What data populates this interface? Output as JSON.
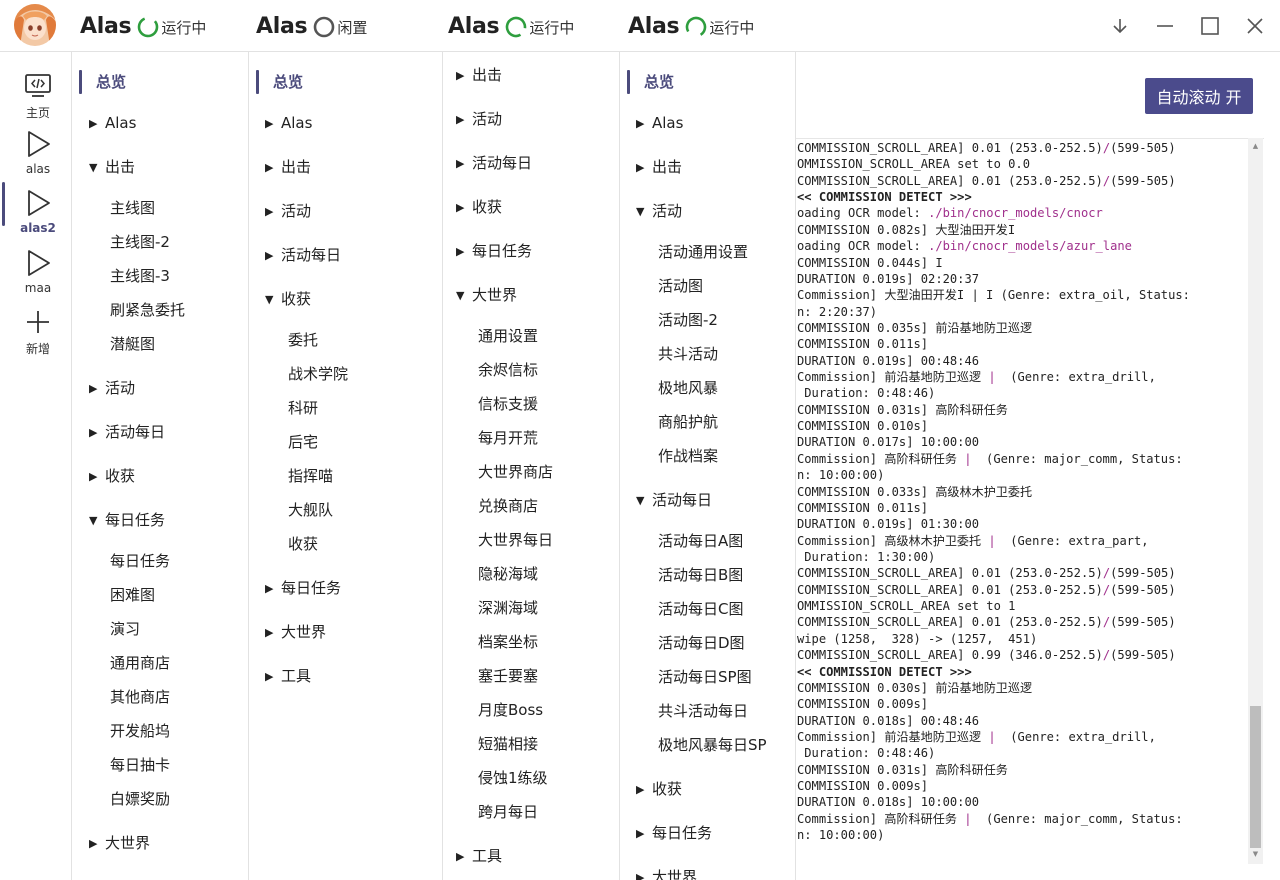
{
  "header": {
    "instances": [
      {
        "name": "Alas",
        "status": "运行中",
        "ring": "running"
      },
      {
        "name": "Alas",
        "status": "闲置",
        "ring": "idle"
      },
      {
        "name": "Alas",
        "status": "运行中",
        "ring": "running"
      },
      {
        "name": "Alas",
        "status": "运行中",
        "ring": "running"
      }
    ],
    "window_controls": [
      "down-arrow-icon",
      "minimize-icon",
      "maximize-icon",
      "close-icon"
    ]
  },
  "rail": {
    "items": [
      {
        "label": "主页",
        "icon": "code-monitor-icon",
        "active": false
      },
      {
        "label": "alas",
        "icon": "play-icon",
        "active": false
      },
      {
        "label": "alas2",
        "icon": "play-icon",
        "active": true
      },
      {
        "label": "maa",
        "icon": "play-icon",
        "active": false
      },
      {
        "label": "新增",
        "icon": "plus-icon",
        "active": false
      }
    ]
  },
  "columns": [
    {
      "items": [
        {
          "label": "总览",
          "type": "overview"
        },
        {
          "label": "Alas",
          "type": "group",
          "expanded": false
        },
        {
          "label": "出击",
          "type": "group",
          "expanded": true
        },
        {
          "label": "主线图",
          "type": "sub"
        },
        {
          "label": "主线图-2",
          "type": "sub"
        },
        {
          "label": "主线图-3",
          "type": "sub"
        },
        {
          "label": "刷紧急委托",
          "type": "sub"
        },
        {
          "label": "潜艇图",
          "type": "sub"
        },
        {
          "label": "活动",
          "type": "group",
          "expanded": false
        },
        {
          "label": "活动每日",
          "type": "group",
          "expanded": false
        },
        {
          "label": "收获",
          "type": "group",
          "expanded": false
        },
        {
          "label": "每日任务",
          "type": "group",
          "expanded": true
        },
        {
          "label": "每日任务",
          "type": "sub"
        },
        {
          "label": "困难图",
          "type": "sub"
        },
        {
          "label": "演习",
          "type": "sub"
        },
        {
          "label": "通用商店",
          "type": "sub"
        },
        {
          "label": "其他商店",
          "type": "sub"
        },
        {
          "label": "开发船坞",
          "type": "sub"
        },
        {
          "label": "每日抽卡",
          "type": "sub"
        },
        {
          "label": "白嫖奖励",
          "type": "sub"
        },
        {
          "label": "大世界",
          "type": "group",
          "expanded": false
        }
      ]
    },
    {
      "items": [
        {
          "label": "总览",
          "type": "overview"
        },
        {
          "label": "Alas",
          "type": "group",
          "expanded": false
        },
        {
          "label": "出击",
          "type": "group",
          "expanded": false
        },
        {
          "label": "活动",
          "type": "group",
          "expanded": false
        },
        {
          "label": "活动每日",
          "type": "group",
          "expanded": false
        },
        {
          "label": "收获",
          "type": "group",
          "expanded": true
        },
        {
          "label": "委托",
          "type": "sub"
        },
        {
          "label": "战术学院",
          "type": "sub"
        },
        {
          "label": "科研",
          "type": "sub"
        },
        {
          "label": "后宅",
          "type": "sub"
        },
        {
          "label": "指挥喵",
          "type": "sub"
        },
        {
          "label": "大舰队",
          "type": "sub"
        },
        {
          "label": "收获",
          "type": "sub"
        },
        {
          "label": "每日任务",
          "type": "group",
          "expanded": false
        },
        {
          "label": "大世界",
          "type": "group",
          "expanded": false
        },
        {
          "label": "工具",
          "type": "group",
          "expanded": false
        }
      ]
    },
    {
      "items": [
        {
          "label": "出击",
          "type": "group",
          "expanded": false
        },
        {
          "label": "活动",
          "type": "group",
          "expanded": false
        },
        {
          "label": "活动每日",
          "type": "group",
          "expanded": false
        },
        {
          "label": "收获",
          "type": "group",
          "expanded": false
        },
        {
          "label": "每日任务",
          "type": "group",
          "expanded": false
        },
        {
          "label": "大世界",
          "type": "group",
          "expanded": true
        },
        {
          "label": "通用设置",
          "type": "sub"
        },
        {
          "label": "余烬信标",
          "type": "sub"
        },
        {
          "label": "信标支援",
          "type": "sub"
        },
        {
          "label": "每月开荒",
          "type": "sub"
        },
        {
          "label": "大世界商店",
          "type": "sub"
        },
        {
          "label": "兑换商店",
          "type": "sub"
        },
        {
          "label": "大世界每日",
          "type": "sub"
        },
        {
          "label": "隐秘海域",
          "type": "sub"
        },
        {
          "label": "深渊海域",
          "type": "sub"
        },
        {
          "label": "档案坐标",
          "type": "sub"
        },
        {
          "label": "塞壬要塞",
          "type": "sub"
        },
        {
          "label": "月度Boss",
          "type": "sub"
        },
        {
          "label": "短猫相接",
          "type": "sub"
        },
        {
          "label": "侵蚀1练级",
          "type": "sub"
        },
        {
          "label": "跨月每日",
          "type": "sub"
        },
        {
          "label": "工具",
          "type": "group",
          "expanded": false
        }
      ]
    },
    {
      "items": [
        {
          "label": "总览",
          "type": "overview"
        },
        {
          "label": "Alas",
          "type": "group",
          "expanded": false
        },
        {
          "label": "出击",
          "type": "group",
          "expanded": false
        },
        {
          "label": "活动",
          "type": "group",
          "expanded": true
        },
        {
          "label": "活动通用设置",
          "type": "sub"
        },
        {
          "label": "活动图",
          "type": "sub"
        },
        {
          "label": "活动图-2",
          "type": "sub"
        },
        {
          "label": "共斗活动",
          "type": "sub"
        },
        {
          "label": "极地风暴",
          "type": "sub"
        },
        {
          "label": "商船护航",
          "type": "sub"
        },
        {
          "label": "作战档案",
          "type": "sub"
        },
        {
          "label": "活动每日",
          "type": "group",
          "expanded": true
        },
        {
          "label": "活动每日A图",
          "type": "sub"
        },
        {
          "label": "活动每日B图",
          "type": "sub"
        },
        {
          "label": "活动每日C图",
          "type": "sub"
        },
        {
          "label": "活动每日D图",
          "type": "sub"
        },
        {
          "label": "活动每日SP图",
          "type": "sub"
        },
        {
          "label": "共斗活动每日",
          "type": "sub"
        },
        {
          "label": "极地风暴每日SP",
          "type": "sub"
        },
        {
          "label": "收获",
          "type": "group",
          "expanded": false
        },
        {
          "label": "每日任务",
          "type": "group",
          "expanded": false
        },
        {
          "label": "大世界",
          "type": "group",
          "expanded": false
        }
      ]
    }
  ],
  "log": {
    "autoscroll_label": "自动滚动 开",
    "lines": [
      {
        "parts": [
          {
            "t": "COMMISSION_SCROLL_AREA] 0.01 (253.0-252.5)"
          },
          {
            "t": "/",
            "c": "path"
          },
          {
            "t": "(599-505)"
          }
        ]
      },
      {
        "parts": [
          {
            "t": "OMMISSION_SCROLL_AREA set to 0.0"
          }
        ]
      },
      {
        "parts": [
          {
            "t": "COMMISSION_SCROLL_AREA] 0.01 (253.0-252.5)"
          },
          {
            "t": "/",
            "c": "path"
          },
          {
            "t": "(599-505)"
          }
        ]
      },
      {
        "parts": [
          {
            "t": "<< COMMISSION DETECT >>>",
            "c": "bold"
          }
        ]
      },
      {
        "parts": [
          {
            "t": "oading OCR model: "
          },
          {
            "t": "./bin/cnocr_models/cnocr",
            "c": "path"
          }
        ]
      },
      {
        "parts": [
          {
            "t": "COMMISSION 0.082s] 大型油田开发I"
          }
        ]
      },
      {
        "parts": [
          {
            "t": "oading OCR model: "
          },
          {
            "t": "./bin/cnocr_models/azur_lane",
            "c": "path"
          }
        ]
      },
      {
        "parts": [
          {
            "t": "COMMISSION 0.044s] I"
          }
        ]
      },
      {
        "parts": [
          {
            "t": "DURATION 0.019s] 02:20:37"
          }
        ]
      },
      {
        "parts": [
          {
            "t": "Commission] 大型油田开发I | I (Genre: extra_oil, Status:"
          }
        ]
      },
      {
        "parts": [
          {
            "t": "n: 2:20:37)"
          }
        ]
      },
      {
        "parts": [
          {
            "t": "COMMISSION 0.035s] 前沿基地防卫巡逻"
          }
        ]
      },
      {
        "parts": [
          {
            "t": "COMMISSION 0.011s]"
          }
        ]
      },
      {
        "parts": [
          {
            "t": "DURATION 0.019s] 00:48:46"
          }
        ]
      },
      {
        "parts": [
          {
            "t": "Commission] 前沿基地防卫巡逻 "
          },
          {
            "t": "|",
            "c": "path"
          },
          {
            "t": "  (Genre: extra_drill,"
          }
        ]
      },
      {
        "parts": [
          {
            "t": " Duration: 0:48:46)"
          }
        ]
      },
      {
        "parts": [
          {
            "t": "COMMISSION 0.031s] 高阶科研任务"
          }
        ]
      },
      {
        "parts": [
          {
            "t": "COMMISSION 0.010s]"
          }
        ]
      },
      {
        "parts": [
          {
            "t": "DURATION 0.017s] 10:00:00"
          }
        ]
      },
      {
        "parts": [
          {
            "t": "Commission] 高阶科研任务 "
          },
          {
            "t": "|",
            "c": "path"
          },
          {
            "t": "  (Genre: major_comm, Status:"
          }
        ]
      },
      {
        "parts": [
          {
            "t": "n: 10:00:00)"
          }
        ]
      },
      {
        "parts": [
          {
            "t": "COMMISSION 0.033s] 高级林木护卫委托"
          }
        ]
      },
      {
        "parts": [
          {
            "t": "COMMISSION 0.011s]"
          }
        ]
      },
      {
        "parts": [
          {
            "t": "DURATION 0.019s] 01:30:00"
          }
        ]
      },
      {
        "parts": [
          {
            "t": "Commission] 高级林木护卫委托 "
          },
          {
            "t": "|",
            "c": "path"
          },
          {
            "t": "  (Genre: extra_part,"
          }
        ]
      },
      {
        "parts": [
          {
            "t": " Duration: 1:30:00)"
          }
        ]
      },
      {
        "parts": [
          {
            "t": "COMMISSION_SCROLL_AREA] 0.01 (253.0-252.5)"
          },
          {
            "t": "/",
            "c": "path"
          },
          {
            "t": "(599-505)"
          }
        ]
      },
      {
        "parts": [
          {
            "t": "COMMISSION_SCROLL_AREA] 0.01 (253.0-252.5)"
          },
          {
            "t": "/",
            "c": "path"
          },
          {
            "t": "(599-505)"
          }
        ]
      },
      {
        "parts": [
          {
            "t": "OMMISSION_SCROLL_AREA set to 1"
          }
        ]
      },
      {
        "parts": [
          {
            "t": "COMMISSION_SCROLL_AREA] 0.01 (253.0-252.5)"
          },
          {
            "t": "/",
            "c": "path"
          },
          {
            "t": "(599-505)"
          }
        ]
      },
      {
        "parts": [
          {
            "t": "wipe (1258,  328) -> (1257,  451)"
          }
        ]
      },
      {
        "parts": [
          {
            "t": "COMMISSION_SCROLL_AREA] 0.99 (346.0-252.5)"
          },
          {
            "t": "/",
            "c": "path"
          },
          {
            "t": "(599-505)"
          }
        ]
      },
      {
        "parts": [
          {
            "t": "<< COMMISSION DETECT >>>",
            "c": "bold"
          }
        ]
      },
      {
        "parts": [
          {
            "t": "COMMISSION 0.030s] 前沿基地防卫巡逻"
          }
        ]
      },
      {
        "parts": [
          {
            "t": "COMMISSION 0.009s]"
          }
        ]
      },
      {
        "parts": [
          {
            "t": "DURATION 0.018s] 00:48:46"
          }
        ]
      },
      {
        "parts": [
          {
            "t": "Commission] 前沿基地防卫巡逻 "
          },
          {
            "t": "|",
            "c": "path"
          },
          {
            "t": "  (Genre: extra_drill,"
          }
        ]
      },
      {
        "parts": [
          {
            "t": " Duration: 0:48:46)"
          }
        ]
      },
      {
        "parts": [
          {
            "t": "COMMISSION 0.031s] 高阶科研任务"
          }
        ]
      },
      {
        "parts": [
          {
            "t": "COMMISSION 0.009s]"
          }
        ]
      },
      {
        "parts": [
          {
            "t": "DURATION 0.018s] 10:00:00"
          }
        ]
      },
      {
        "parts": [
          {
            "t": "Commission] 高阶科研任务 "
          },
          {
            "t": "|",
            "c": "path"
          },
          {
            "t": "  (Genre: major_comm, Status:"
          }
        ]
      },
      {
        "parts": [
          {
            "t": "n: 10:00:00)"
          }
        ]
      }
    ]
  },
  "colors": {
    "accent": "#4b4b7c",
    "button": "#4b4b8c",
    "ring_running": "#2e9e3e",
    "ring_idle": "#555555",
    "path": "#a0308c"
  }
}
